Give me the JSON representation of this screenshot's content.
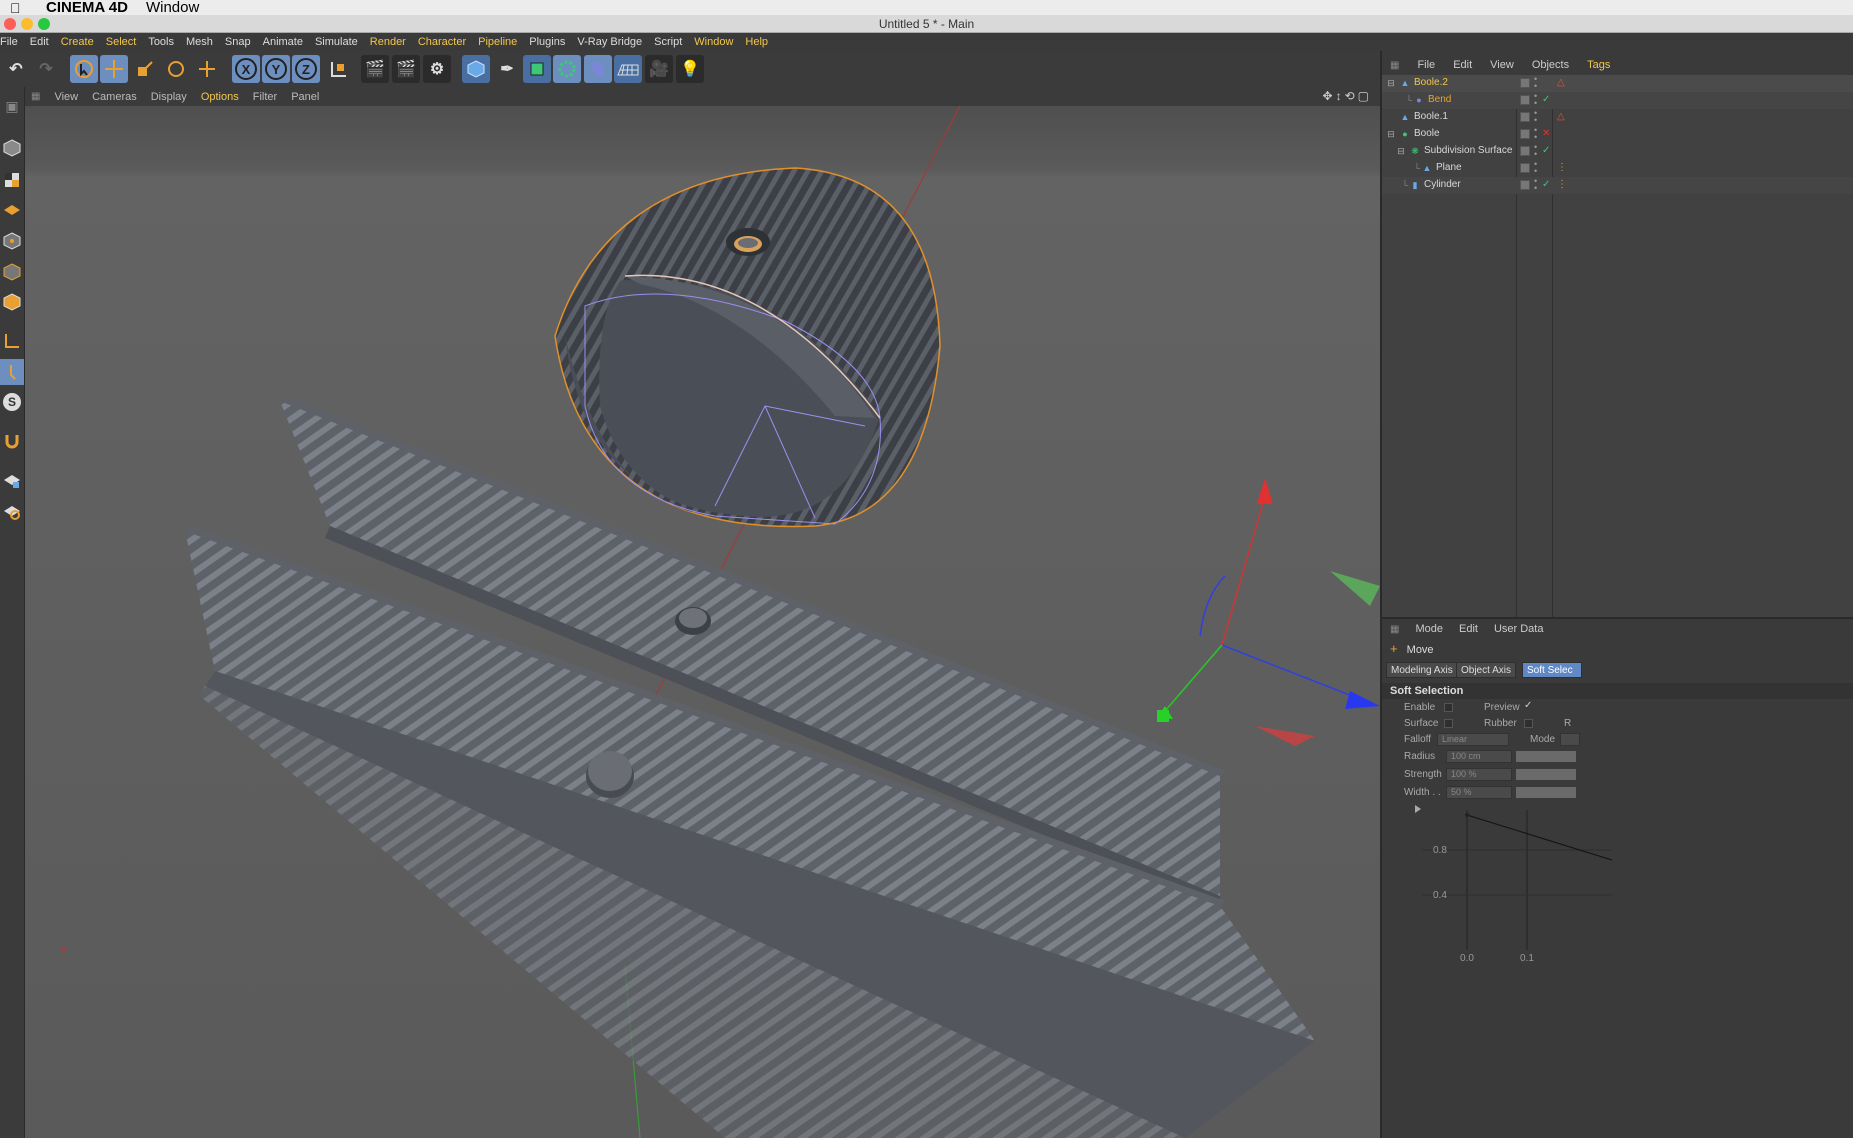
{
  "os_menubar": {
    "app_name": "CINEMA 4D",
    "menu_window": "Window"
  },
  "window": {
    "title": "Untitled 5 * - Main"
  },
  "main_menu": [
    {
      "label": "File",
      "hl": false
    },
    {
      "label": "Edit",
      "hl": false
    },
    {
      "label": "Create",
      "hl": true
    },
    {
      "label": "Select",
      "hl": true
    },
    {
      "label": "Tools",
      "hl": false
    },
    {
      "label": "Mesh",
      "hl": false
    },
    {
      "label": "Snap",
      "hl": false
    },
    {
      "label": "Animate",
      "hl": false
    },
    {
      "label": "Simulate",
      "hl": false
    },
    {
      "label": "Render",
      "hl": true
    },
    {
      "label": "Character",
      "hl": true
    },
    {
      "label": "Pipeline",
      "hl": true
    },
    {
      "label": "Plugins",
      "hl": false
    },
    {
      "label": "V-Ray Bridge",
      "hl": false
    },
    {
      "label": "Script",
      "hl": false
    },
    {
      "label": "Window",
      "hl": true
    },
    {
      "label": "Help",
      "hl": true
    }
  ],
  "toolbar": {
    "axis_x": "X",
    "axis_y": "Y",
    "axis_z": "Z"
  },
  "viewport_menu": {
    "view": "View",
    "cameras": "Cameras",
    "display": "Display",
    "options": "Options",
    "filter": "Filter",
    "panel": "Panel"
  },
  "viewport": {
    "axis_marker": "x"
  },
  "object_manager": {
    "menu": {
      "file": "File",
      "edit": "Edit",
      "view": "View",
      "objects": "Objects",
      "tags": "Tags"
    },
    "objects": [
      {
        "name": "Boole.2",
        "color": "#f3c64c",
        "flag": "△"
      },
      {
        "name": "Bend",
        "color": "#e8a030",
        "flag": "✓"
      },
      {
        "name": "Boole.1",
        "color": "#d8d8d8",
        "flag": "△"
      },
      {
        "name": "Boole",
        "color": "#d8d8d8",
        "flag": "✕"
      },
      {
        "name": "Subdivision Surface",
        "color": "#d8d8d8",
        "flag": "✓"
      },
      {
        "name": "Plane",
        "color": "#d8d8d8",
        "flag": ""
      },
      {
        "name": "Cylinder",
        "color": "#d8d8d8",
        "flag": "✓"
      }
    ]
  },
  "attributes": {
    "menu": {
      "mode": "Mode",
      "edit": "Edit",
      "user_data": "User Data"
    },
    "tool_name": "Move",
    "tabs": {
      "modeling_axis": "Modeling Axis",
      "object_axis": "Object Axis",
      "soft_selection": "Soft Selec"
    },
    "section": "Soft Selection",
    "fields": {
      "enable": "Enable",
      "preview": "Preview",
      "surface": "Surface",
      "rubber": "Rubber",
      "r_cut": "R",
      "falloff": "Falloff",
      "falloff_value": "Linear",
      "mode": "Mode",
      "radius": "Radius",
      "radius_value": "100 cm",
      "strength": "Strength",
      "strength_value": "100 %",
      "width": "Width . .",
      "width_value": "50 %"
    },
    "graph": {
      "y_ticks": [
        "0.8",
        "0.4"
      ],
      "x_ticks": [
        "0.0",
        "0.1"
      ]
    }
  },
  "colors": {
    "accent": "#f3c64c",
    "selection_blue": "#5f88c4",
    "bg_dark": "#3a3a3a",
    "viewport": "#5d5d5d"
  }
}
